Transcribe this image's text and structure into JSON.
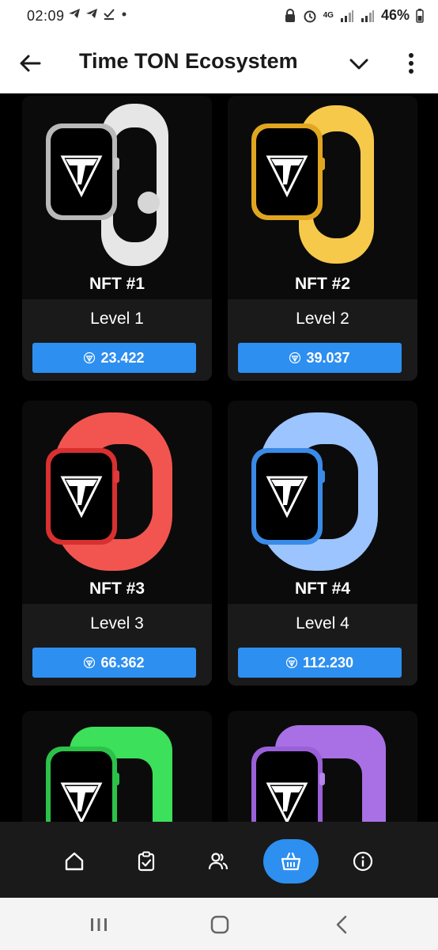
{
  "status_bar": {
    "time": "02:09",
    "battery": "46%",
    "network": "4G"
  },
  "app_bar": {
    "title": "Time TON Ecosystem",
    "back_icon": "arrow-left-icon",
    "dropdown_icon": "chevron-down-icon",
    "menu_icon": "more-vertical-icon"
  },
  "colors": {
    "accent": "#2d8ff0",
    "card_bottom": "#1a1a1a",
    "background": "#000000"
  },
  "nfts": [
    {
      "name": "NFT #1",
      "level": "Level 1",
      "price": "23.422",
      "band_color": "#e6e6e6"
    },
    {
      "name": "NFT #2",
      "level": "Level 2",
      "price": "39.037",
      "band_color": "#f6c94a"
    },
    {
      "name": "NFT #3",
      "level": "Level 3",
      "price": "66.362",
      "band_color": "#f2554f"
    },
    {
      "name": "NFT #4",
      "level": "Level 4",
      "price": "112.230",
      "band_color": "#9cc4ff"
    },
    {
      "name": "",
      "level": "",
      "price": "",
      "band_color": "#3ce05a"
    },
    {
      "name": "",
      "level": "",
      "price": "",
      "band_color": "#a970e6"
    }
  ],
  "bottom_nav": {
    "items": [
      "home-icon",
      "tasks-icon",
      "friends-icon",
      "shop-icon",
      "info-icon"
    ],
    "active": "shop-icon"
  }
}
